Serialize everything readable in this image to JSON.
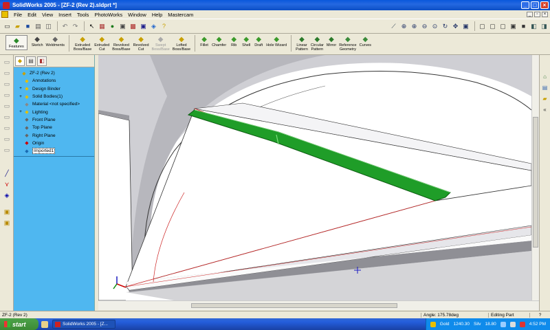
{
  "window": {
    "title": "SolidWorks 2005 - [ZF-2 (Rev 2).sldprt *]"
  },
  "menu": {
    "items": [
      "File",
      "Edit",
      "View",
      "Insert",
      "Tools",
      "PhotoWorks",
      "Window",
      "Help",
      "Mastercam"
    ]
  },
  "commands": [
    {
      "label": "Features",
      "icon": "features-icon",
      "color": "#2a8a2a"
    },
    {
      "label": "Sketch",
      "icon": "sketch-icon",
      "color": "#444"
    },
    {
      "label": "Weldments",
      "icon": "weldments-icon",
      "color": "#666"
    },
    {
      "label": "Extruded\nBoss/Base",
      "icon": "extrude-icon",
      "color": "#c8a000"
    },
    {
      "label": "Extruded\nCut",
      "icon": "extruded-cut-icon",
      "color": "#c8a000"
    },
    {
      "label": "Revolved\nBoss/Base",
      "icon": "revolve-icon",
      "color": "#c8a000"
    },
    {
      "label": "Revolved\nCut",
      "icon": "revolved-cut-icon",
      "color": "#c8a000"
    },
    {
      "label": "Swept\nBoss/Base",
      "icon": "sweep-icon",
      "color": "#aaa",
      "disabled": true
    },
    {
      "label": "Lofted\nBoss/Base",
      "icon": "loft-icon",
      "color": "#c8a000"
    },
    {
      "label": "Fillet",
      "icon": "fillet-icon",
      "color": "#3a9a2a"
    },
    {
      "label": "Chamfer",
      "icon": "chamfer-icon",
      "color": "#3a9a2a"
    },
    {
      "label": "Rib",
      "icon": "rib-icon",
      "color": "#3a9a2a"
    },
    {
      "label": "Shell",
      "icon": "shell-icon",
      "color": "#3a9a2a"
    },
    {
      "label": "Draft",
      "icon": "draft-icon",
      "color": "#3a9a2a"
    },
    {
      "label": "Hole Wizard",
      "icon": "hole-wizard-icon",
      "color": "#3a9a2a"
    },
    {
      "label": "Linear\nPattern",
      "icon": "linear-pattern-icon",
      "color": "#2a7a2a"
    },
    {
      "label": "Circular\nPattern",
      "icon": "circular-pattern-icon",
      "color": "#2a7a2a"
    },
    {
      "label": "Mirror",
      "icon": "mirror-icon",
      "color": "#2a7a2a"
    },
    {
      "label": "Reference\nGeometry",
      "icon": "reference-geometry-icon",
      "color": "#3a8a3a"
    },
    {
      "label": "Curves",
      "icon": "curves-icon",
      "color": "#3a8a3a"
    }
  ],
  "tree": {
    "items": [
      {
        "label": "ZF-2 (Rev 2)",
        "icon": "part-icon",
        "expander": "",
        "color": "#c8a000"
      },
      {
        "label": "Annotations",
        "icon": "annotations-icon",
        "expander": "",
        "color": "#e8c000"
      },
      {
        "label": "Design Binder",
        "icon": "design-binder-icon",
        "expander": "+",
        "color": "#e8c000"
      },
      {
        "label": "Solid Bodies(1)",
        "icon": "solid-bodies-icon",
        "expander": "+",
        "color": "#e8c000"
      },
      {
        "label": "Material <not specified>",
        "icon": "material-icon",
        "expander": "",
        "color": "#888"
      },
      {
        "label": "Lighting",
        "icon": "lighting-icon",
        "expander": "+",
        "color": "#e8c000"
      },
      {
        "label": "Front Plane",
        "icon": "plane-icon",
        "expander": "",
        "color": "#666"
      },
      {
        "label": "Top Plane",
        "icon": "plane-icon",
        "expander": "",
        "color": "#666"
      },
      {
        "label": "Right Plane",
        "icon": "plane-icon",
        "expander": "",
        "color": "#666"
      },
      {
        "label": "Origin",
        "icon": "origin-icon",
        "expander": "",
        "color": "#c00"
      },
      {
        "label": "Imported1",
        "icon": "imported-body-icon",
        "expander": "",
        "color": "#1a6ab0",
        "selected": true
      }
    ]
  },
  "status": {
    "left": "ZF-2 (Rev 2)",
    "angle": "Angle: 175.78deg",
    "mode": "Editing Part",
    "help": "?"
  },
  "taskbar": {
    "start": "start",
    "task": "SolidWorks 2005 - [Z...",
    "tray": {
      "gold_label": "Gold",
      "gold_value": "1240.30",
      "silver_label": "Silv",
      "silver_value": "18.80",
      "clock": "4:52 PM"
    }
  },
  "colors": {
    "accent_green": "#1f9d28",
    "selection_blue": "#4FB7F0",
    "title_blue": "#0A58DC"
  }
}
